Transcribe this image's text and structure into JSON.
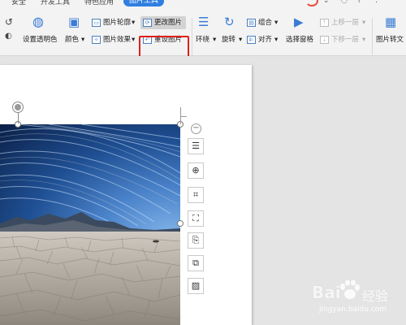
{
  "tabs": {
    "items": [
      {
        "label": "安全"
      },
      {
        "label": "开发工具"
      },
      {
        "label": "特色应用"
      },
      {
        "label": "图片工具"
      }
    ],
    "active_index": 3
  },
  "ribbon": {
    "transparent_label": "设置透明色",
    "color_label": "颜色",
    "outline_label": "图片轮廓",
    "effect_label": "图片效果",
    "change_label": "更改图片",
    "reset_label": "重设图片",
    "wrap_label": "环绕",
    "rotate_label": "旋转",
    "group_label": "组合",
    "align_label": "对齐",
    "selection_pane_label": "选择窗格",
    "bring_forward_label": "上移一层",
    "send_backward_label": "下移一层",
    "convert_label": "图片转文"
  },
  "float_toolbar": {
    "collapse": "−",
    "tools": [
      "layout-icon",
      "zoom-icon",
      "crop-icon",
      "fit-icon",
      "extract-text-icon",
      "image-to-pdf-icon",
      "image-extract-icon"
    ]
  },
  "watermark": {
    "brand": "Bai",
    "brand_cn": "经验",
    "url": "jingyan.baidu.com"
  },
  "colors": {
    "accent": "#2f7fe0",
    "highlight_box": "#e0201b"
  }
}
